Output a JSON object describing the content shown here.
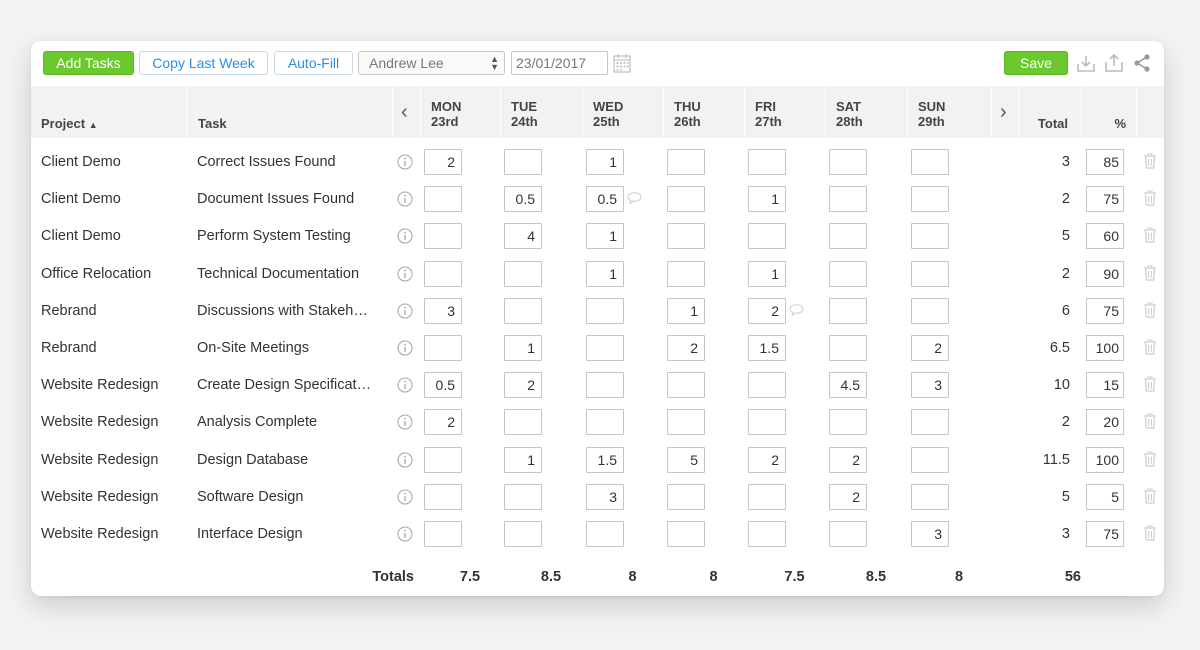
{
  "toolbar": {
    "add_tasks_label": "Add Tasks",
    "copy_last_week_label": "Copy Last Week",
    "auto_fill_label": "Auto-Fill",
    "employee_selected": "Andrew Lee",
    "date_value": "23/01/2017",
    "save_label": "Save",
    "icons": [
      "calendar-icon",
      "download-icon",
      "upload-icon",
      "share-icon"
    ]
  },
  "header": {
    "project": "Project",
    "task": "Task",
    "days": [
      {
        "name": "MON",
        "date": "23rd"
      },
      {
        "name": "TUE",
        "date": "24th"
      },
      {
        "name": "WED",
        "date": "25th"
      },
      {
        "name": "THU",
        "date": "26th"
      },
      {
        "name": "FRI",
        "date": "27th"
      },
      {
        "name": "SAT",
        "date": "28th"
      },
      {
        "name": "SUN",
        "date": "29th"
      }
    ],
    "total": "Total",
    "percent": "%"
  },
  "rows": [
    {
      "project": "Client Demo",
      "task": "Correct Issues Found",
      "hours": [
        "2",
        "",
        "1",
        "",
        "",
        "",
        ""
      ],
      "total": "3",
      "percent": "85",
      "comments": []
    },
    {
      "project": "Client Demo",
      "task": "Document Issues Found",
      "hours": [
        "",
        "0.5",
        "0.5",
        "",
        "1",
        "",
        ""
      ],
      "total": "2",
      "percent": "75",
      "comments": [
        2
      ]
    },
    {
      "project": "Client Demo",
      "task": "Perform System Testing",
      "hours": [
        "",
        "4",
        "1",
        "",
        "",
        "",
        ""
      ],
      "total": "5",
      "percent": "60",
      "comments": []
    },
    {
      "project": "Office Relocation",
      "task": "Technical Documentation",
      "hours": [
        "",
        "",
        "1",
        "",
        "1",
        "",
        ""
      ],
      "total": "2",
      "percent": "90",
      "comments": []
    },
    {
      "project": "Rebrand",
      "task": "Discussions with Stakeholders",
      "hours": [
        "3",
        "",
        "",
        "1",
        "2",
        "",
        ""
      ],
      "total": "6",
      "percent": "75",
      "comments": [
        4
      ]
    },
    {
      "project": "Rebrand",
      "task": "On-Site Meetings",
      "hours": [
        "",
        "1",
        "",
        "2",
        "1.5",
        "",
        "2"
      ],
      "total": "6.5",
      "percent": "100",
      "comments": []
    },
    {
      "project": "Website Redesign",
      "task": "Create Design Specifications",
      "hours": [
        "0.5",
        "2",
        "",
        "",
        "",
        "4.5",
        "3"
      ],
      "total": "10",
      "percent": "15",
      "comments": []
    },
    {
      "project": "Website Redesign",
      "task": "Analysis Complete",
      "hours": [
        "2",
        "",
        "",
        "",
        "",
        "",
        ""
      ],
      "total": "2",
      "percent": "20",
      "comments": []
    },
    {
      "project": "Website Redesign",
      "task": "Design Database",
      "hours": [
        "",
        "1",
        "1.5",
        "5",
        "2",
        "2",
        ""
      ],
      "total": "11.5",
      "percent": "100",
      "comments": []
    },
    {
      "project": "Website Redesign",
      "task": "Software Design",
      "hours": [
        "",
        "",
        "3",
        "",
        "",
        "2",
        ""
      ],
      "total": "5",
      "percent": "5",
      "comments": []
    },
    {
      "project": "Website Redesign",
      "task": "Interface Design",
      "hours": [
        "",
        "",
        "",
        "",
        "",
        "",
        "3"
      ],
      "total": "3",
      "percent": "75",
      "comments": []
    }
  ],
  "totals": {
    "label": "Totals",
    "days": [
      "7.5",
      "8.5",
      "8",
      "8",
      "7.5",
      "8.5",
      "8"
    ],
    "grand_total": "56"
  },
  "colors": {
    "primary_green": "#6bc92d",
    "link_blue": "#2e8ee0",
    "header_bg": "#f2f2f2"
  }
}
